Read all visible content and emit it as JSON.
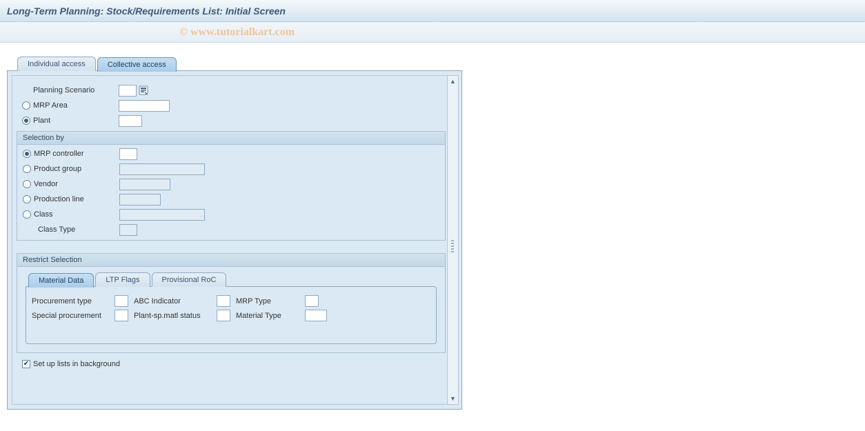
{
  "title": "Long-Term Planning: Stock/Requirements List: Initial Screen",
  "watermark": "© www.tutorialkart.com",
  "outerTabs": {
    "individual": "Individual access",
    "collective": "Collective access"
  },
  "fields": {
    "planningScenario": {
      "label": "Planning Scenario",
      "value": ""
    },
    "mrpArea": {
      "label": "MRP Area",
      "value": ""
    },
    "plant": {
      "label": "Plant",
      "value": ""
    }
  },
  "selectionBy": {
    "title": "Selection by",
    "mrpController": {
      "label": "MRP controller",
      "value": ""
    },
    "productGroup": {
      "label": "Product group",
      "value": ""
    },
    "vendor": {
      "label": "Vendor",
      "value": ""
    },
    "productionLine": {
      "label": "Production line",
      "value": ""
    },
    "classField": {
      "label": "Class",
      "value": ""
    },
    "classType": {
      "label": "Class Type",
      "value": ""
    }
  },
  "restrict": {
    "title": "Restrict Selection",
    "tabs": {
      "materialData": "Material Data",
      "ltpFlags": "LTP Flags",
      "provisionalRoc": "Provisional RoC"
    },
    "materialData": {
      "procurementType": "Procurement type",
      "abcIndicator": "ABC Indicator",
      "mrpType": "MRP Type",
      "specialProcurement": "Special procurement",
      "plantSpStatus": "Plant-sp.matl status",
      "materialType": "Material Type"
    }
  },
  "footer": {
    "setupLists": "Set up lists in background"
  }
}
